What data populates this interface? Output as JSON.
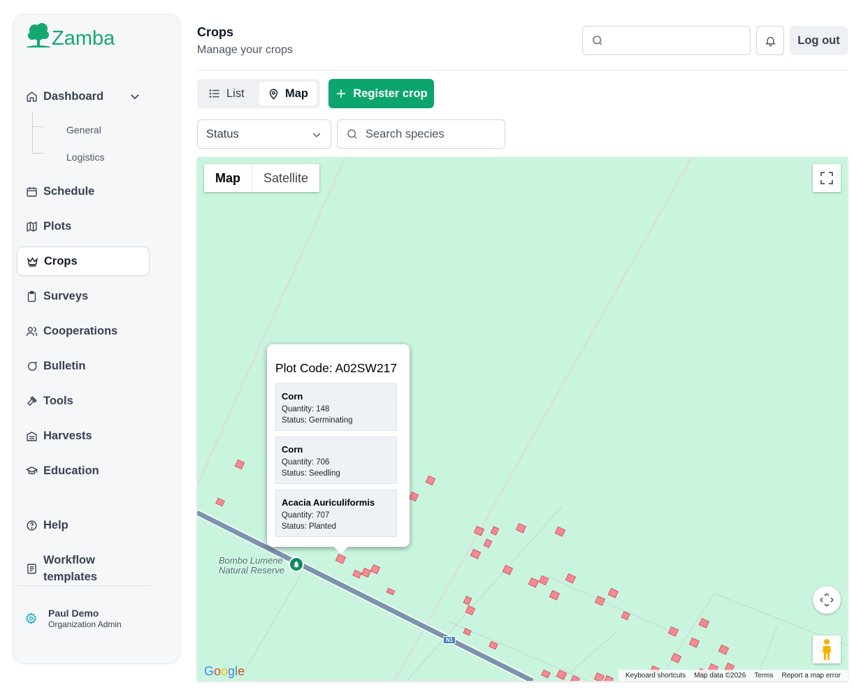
{
  "brand": {
    "name": "Zamba",
    "color": "#16a871"
  },
  "sidebar": {
    "dashboard": {
      "label": "Dashboard",
      "icon": "home-icon",
      "children": [
        {
          "label": "General"
        },
        {
          "label": "Logistics"
        }
      ]
    },
    "items": [
      {
        "label": "Schedule",
        "icon": "calendar-icon"
      },
      {
        "label": "Plots",
        "icon": "map-icon"
      },
      {
        "label": "Crops",
        "icon": "crown-icon",
        "active": true
      },
      {
        "label": "Surveys",
        "icon": "clipboard-icon"
      },
      {
        "label": "Cooperations",
        "icon": "users-icon"
      },
      {
        "label": "Bulletin",
        "icon": "chat-icon"
      },
      {
        "label": "Tools",
        "icon": "hammer-icon"
      },
      {
        "label": "Harvests",
        "icon": "warehouse-icon"
      },
      {
        "label": "Education",
        "icon": "graduation-cap-icon"
      }
    ],
    "help": {
      "label": "Help",
      "icon": "help-circle-icon"
    },
    "workflow": {
      "label_line1": "Workflow",
      "label_line2": "templates",
      "icon": "document-icon"
    },
    "user": {
      "name": "Paul Demo",
      "role": "Organization Admin",
      "icon": "settings-icon"
    }
  },
  "header": {
    "title": "Crops",
    "subtitle": "Manage your crops",
    "search_placeholder": "",
    "logout_label": "Log out"
  },
  "toolbar": {
    "list_label": "List",
    "map_label": "Map",
    "active_view": "Map",
    "register_label": "Register crop",
    "status_label": "Status",
    "species_placeholder": "Search species"
  },
  "map": {
    "type_map_label": "Map",
    "type_satellite_label": "Satellite",
    "active_type": "Map",
    "reserve_line1": "Bombo Lumene",
    "reserve_line2": "Natural Reserve",
    "road_label": "N1",
    "google_logo": "Google",
    "attribution": {
      "shortcuts": "Keyboard shortcuts",
      "data": "Map data ©2026",
      "terms": "Terms",
      "report": "Report a map error"
    },
    "land_color": "#c9f5df",
    "plot_color": "#f28b93"
  },
  "info_window": {
    "title_label": "Plot Code",
    "title_value": "A02SW217",
    "crops": [
      {
        "name": "Corn",
        "quantity": "Quantity: 148",
        "status": "Status: Germinating"
      },
      {
        "name": "Corn",
        "quantity": "Quantity: 706",
        "status": "Status: Seedling"
      },
      {
        "name": "Acacia Auriculiformis",
        "quantity": "Quantity: 707",
        "status": "Status: Planted"
      }
    ]
  }
}
